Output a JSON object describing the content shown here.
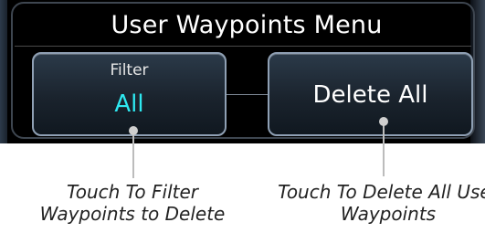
{
  "menu": {
    "title": "User Waypoints Menu"
  },
  "buttons": {
    "filter_label": "Filter",
    "filter_value": "All",
    "delete_all_label": "Delete All"
  },
  "callouts": {
    "filter_line1": "Touch To Filter",
    "filter_line2": "Waypoints to Delete",
    "delete_line1": "Touch To Delete All User",
    "delete_line2": "Waypoints"
  },
  "colors": {
    "panel_background": "#000000",
    "filter_value_cyan": "#2ee8f0",
    "button_border": "#8fa0b4",
    "callout_text": "#222222"
  }
}
